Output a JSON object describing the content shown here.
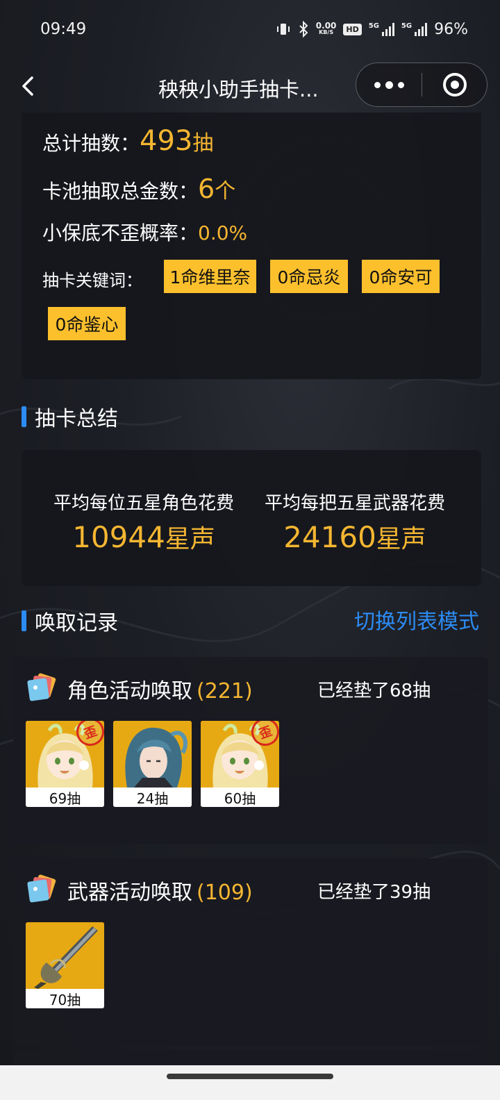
{
  "status_bar": {
    "time": "09:49",
    "net_speed_value": "0.00",
    "net_speed_unit": "KB/S",
    "hd_badge": "HD",
    "sim1_label": "5G",
    "sim2_label": "5G",
    "battery": "96%"
  },
  "nav": {
    "title": "秧秧小助手抽卡...",
    "icons": [
      "back-icon",
      "more-icon",
      "close-mini-program-icon"
    ]
  },
  "stats": {
    "total_pulls_label": "总计抽数：",
    "total_pulls_value": "493",
    "total_pulls_unit": "抽",
    "gold_count_label": "卡池抽取总金数：",
    "gold_count_value": "6",
    "gold_count_unit": "个",
    "win_rate_label": "小保底不歪概率：",
    "win_rate_value": "0.0%",
    "keywords_label": "抽卡关键词：",
    "keywords": [
      "1命维里奈",
      "0命忌炎",
      "0命安可",
      "0命鉴心"
    ]
  },
  "summary": {
    "section_title": "抽卡总结",
    "avg_character_label": "平均每位五星角色花费",
    "avg_character_value": "10944",
    "avg_character_unit": "星声",
    "avg_weapon_label": "平均每把五星武器花费",
    "avg_weapon_value": "24160",
    "avg_weapon_unit": "星声"
  },
  "records": {
    "section_title": "唤取记录",
    "switch_label": "切换列表模式",
    "pools": [
      {
        "title": "角色活动唤取",
        "count": "(221)",
        "pity": "已经垫了68抽",
        "pulls": [
          {
            "label": "69抽",
            "lost": true,
            "stamp": "歪"
          },
          {
            "label": "24抽",
            "lost": false
          },
          {
            "label": "60抽",
            "lost": true,
            "stamp": "歪"
          }
        ]
      },
      {
        "title": "武器活动唤取",
        "count": "(109)",
        "pity": "已经垫了39抽",
        "pulls": [
          {
            "label": "70抽",
            "lost": false
          }
        ]
      }
    ]
  },
  "colors": {
    "accent_gold": "#f5b631",
    "tag_yellow": "#fdc02d",
    "accent_blue": "#2c8cf4",
    "stamp_red": "#d8281c"
  }
}
